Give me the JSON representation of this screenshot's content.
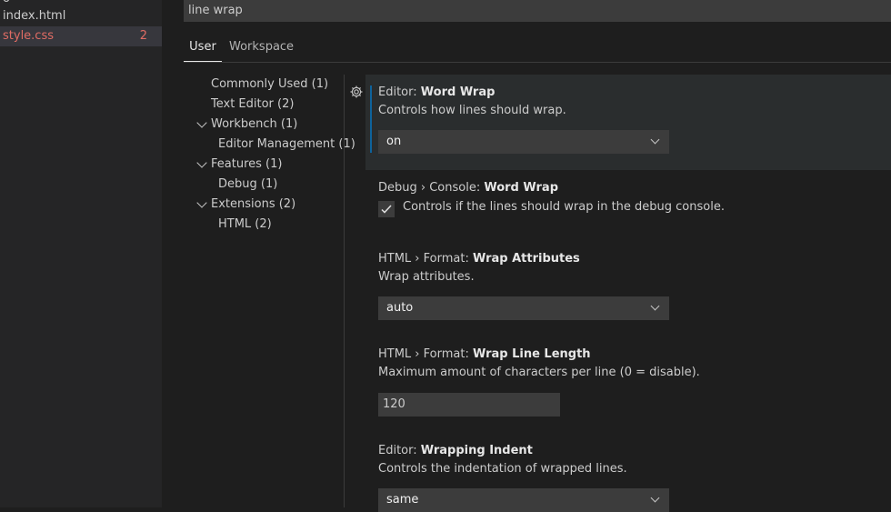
{
  "explorer": {
    "items": [
      {
        "label": "o"
      },
      {
        "label": "index.html"
      },
      {
        "label": "style.css",
        "badge": "2"
      }
    ]
  },
  "settings": {
    "search_value": "line wrap",
    "tabs": [
      {
        "label": "User"
      },
      {
        "label": "Workspace"
      }
    ],
    "toc": [
      {
        "label": "Commonly Used (1)"
      },
      {
        "label": "Text Editor (2)"
      },
      {
        "label": "Workbench (1)"
      },
      {
        "label": "Editor Management (1)"
      },
      {
        "label": "Features (1)"
      },
      {
        "label": "Debug (1)"
      },
      {
        "label": "Extensions (2)"
      },
      {
        "label": "HTML (2)"
      }
    ],
    "items": [
      {
        "category": "Editor: ",
        "name": "Word Wrap",
        "description": "Controls how lines should wrap.",
        "value": "on"
      },
      {
        "category": "Debug › Console: ",
        "name": "Word Wrap",
        "description": "Controls if the lines should wrap in the debug console.",
        "checked": true
      },
      {
        "category": "HTML › Format: ",
        "name": "Wrap Attributes",
        "description": "Wrap attributes.",
        "value": "auto"
      },
      {
        "category": "HTML › Format: ",
        "name": "Wrap Line Length",
        "description": "Maximum amount of characters per line (0 = disable).",
        "value": "120"
      },
      {
        "category": "Editor: ",
        "name": "Wrapping Indent",
        "description": "Controls the indentation of wrapped lines.",
        "value": "same"
      }
    ]
  },
  "colors": {
    "modified_file": "#e06c64",
    "focus_bar": "#0e639c",
    "background": "#1e1e1e"
  }
}
